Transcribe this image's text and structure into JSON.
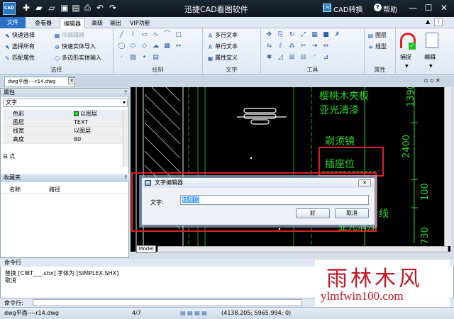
{
  "app": {
    "logo": "CAD",
    "title": "迅捷CAD看图软件",
    "cad_convert": "CAD转换",
    "help": "帮助"
  },
  "tabs": [
    "文件",
    "查看器",
    "编辑器",
    "高级",
    "输出",
    "VIP功能"
  ],
  "ribbon": {
    "select_group": {
      "label": "选择",
      "items": [
        "快速选择",
        "选择所有",
        "匹配属性",
        "块编辑器",
        "快速实体导入",
        "多边形实体输入"
      ]
    },
    "draw_group": {
      "label": "绘制"
    },
    "text_group": {
      "label": "文字",
      "items": [
        "多行文本",
        "单行文本",
        "属性定义"
      ]
    },
    "tools_group": {
      "label": "工具"
    },
    "props_group": {
      "label": "属性",
      "items": [
        "图层",
        "线型"
      ]
    },
    "capture": "捕捉",
    "edit": "编辑"
  },
  "document": {
    "tab": "dwg平面----r14.dwg"
  },
  "properties_panel": {
    "title": "属性",
    "selected_type": "文字",
    "rows": [
      {
        "key": "色彩",
        "value": "以图层"
      },
      {
        "key": "图层",
        "value": "TEXT"
      },
      {
        "key": "线宽",
        "value": "以图层"
      },
      {
        "key": "高度",
        "value": "80"
      }
    ],
    "point_row": "点"
  },
  "favorites_panel": {
    "title": "收藏夹",
    "col_name": "名称",
    "col_path": "路径"
  },
  "canvas": {
    "texts": [
      "樱桃木夹板",
      "亚光清漆",
      "剃须镜",
      "插座位",
      "线",
      "亚光清漆"
    ],
    "dimensions": [
      "1390",
      "2400",
      "100",
      "730"
    ],
    "model_tab": "Model"
  },
  "dialog": {
    "title": "文字编辑器",
    "label": "文字:",
    "value": "插座位",
    "ok": "好",
    "cancel": "取消"
  },
  "command": {
    "title": "命令行",
    "lines": [
      "替换 [CIBT___.shx] 字体为 [SIMPLEX.SHX]",
      "取消"
    ],
    "input_label": "命令行:"
  },
  "statusbar": {
    "file": "dwg平面----r14.dwg",
    "page": "4/7",
    "coords": "(4138.205; 5965.994; 0)"
  },
  "watermark": {
    "cn": "雨林木风",
    "url": "ylmfwin100.com"
  }
}
